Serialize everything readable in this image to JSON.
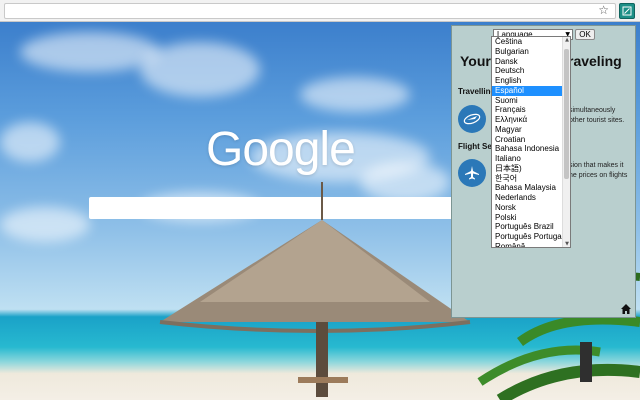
{
  "browser": {
    "address_value": "",
    "bookmark_icon": "star-icon",
    "extension_icon": "translate-extension-icon"
  },
  "newtab": {
    "logo_text": "Google",
    "search_value": ""
  },
  "popup": {
    "title_left": "Your",
    "title_right": "raveling",
    "language_select": {
      "selected": "Language",
      "ok_label": "OK",
      "options": [
        "Čeština",
        "Bulgarian",
        "Dansk",
        "Deutsch",
        "English",
        "Español",
        "Suomi",
        "Français",
        "Ελληνικά",
        "Magyar",
        "Croatian",
        "Bahasa Indonesia",
        "Italiano",
        "日本語)",
        "한국어",
        "Bahasa Malaysia",
        "Nederlands",
        "Norsk",
        "Polski",
        "Português Brazil",
        "Português Portugal",
        "Română"
      ],
      "highlighted": "Español"
    },
    "sections": [
      {
        "heading": "Travelling",
        "desc_lines": [
          "simultaneously",
          "other tourist sites."
        ],
        "icon": "airplane-globe-icon"
      },
      {
        "heading": "Flight Se",
        "desc_lines": [
          "sion that makes it",
          "he prices on flights"
        ],
        "icon": "airplane-icon"
      }
    ],
    "home_icon": "home-icon"
  },
  "colors": {
    "popup_bg": "#b9cfce",
    "highlight": "#1e90ff",
    "feature_icon": "#2b78b8"
  }
}
